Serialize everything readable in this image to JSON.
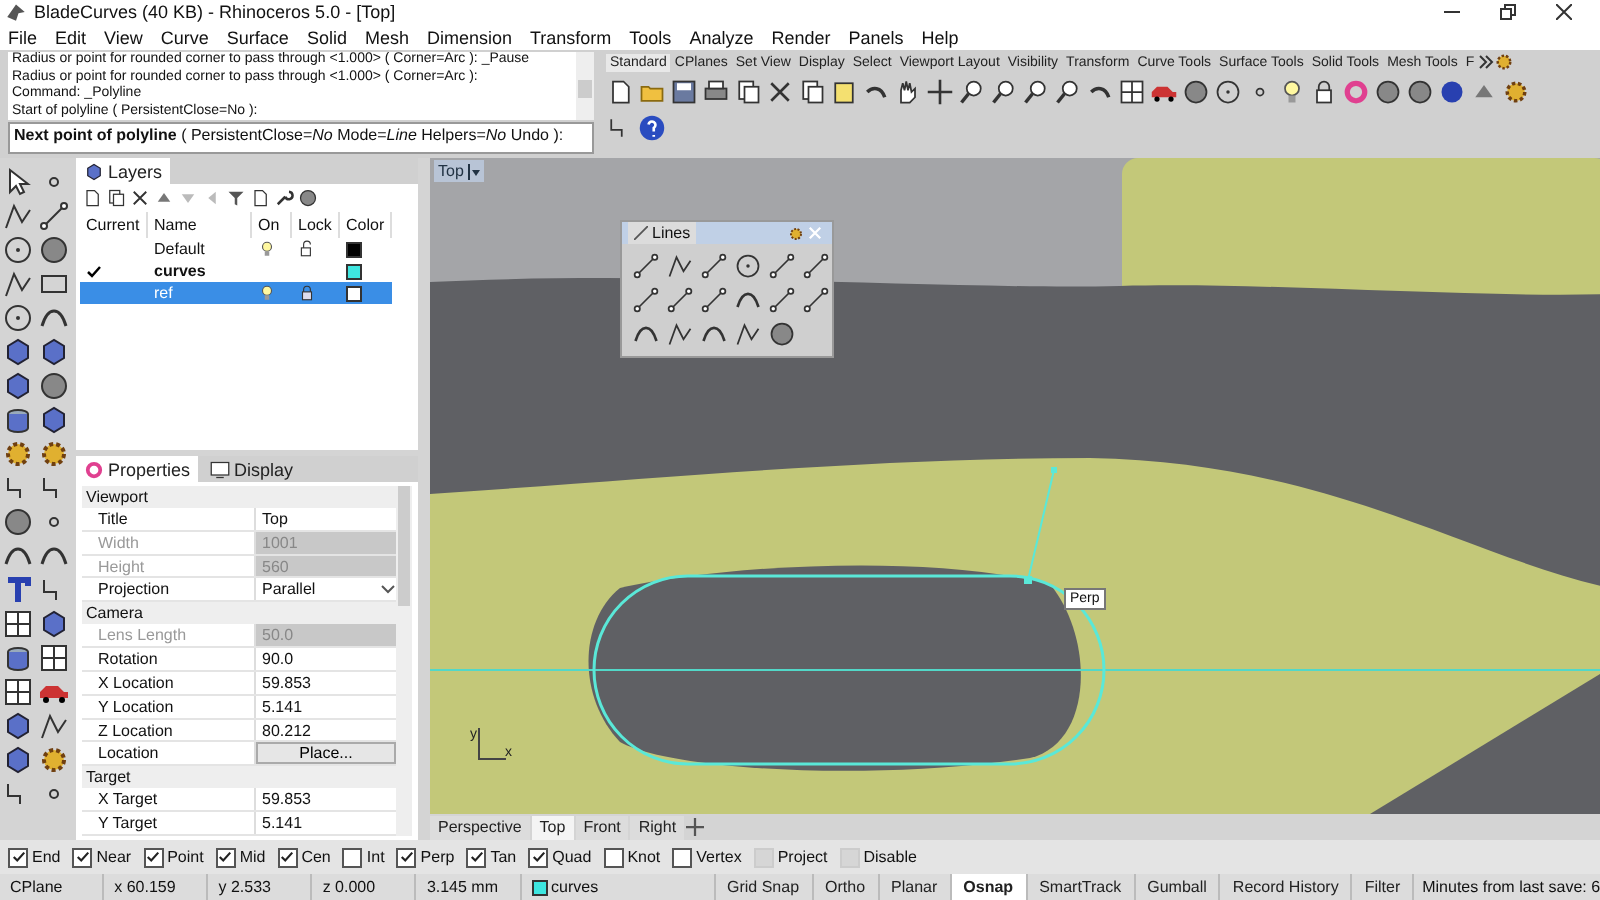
{
  "window": {
    "title": "BladeCurves (40 KB) - Rhinoceros 5.0 - [Top]"
  },
  "menu": [
    "File",
    "Edit",
    "View",
    "Curve",
    "Surface",
    "Solid",
    "Mesh",
    "Dimension",
    "Transform",
    "Tools",
    "Analyze",
    "Render",
    "Panels",
    "Help"
  ],
  "command": {
    "history": [
      "Radius or point for rounded corner to pass through <1.000> ( Corner=Arc ): _Pause",
      "Radius or point for rounded corner to pass through <1.000> ( Corner=Arc ):",
      "Command: _Polyline",
      "Start of polyline ( PersistentClose=No ):"
    ],
    "prompt": "**Next point of polyline** ( PersistentClose=*No* Mode=*Line* Helpers=*No* Undo ):"
  },
  "toolbar_tabs": [
    {
      "label": "Standard",
      "selected": true
    },
    {
      "label": "CPlanes",
      "selected": false
    },
    {
      "label": "Set View",
      "selected": false
    },
    {
      "label": "Display",
      "selected": false
    },
    {
      "label": "Select",
      "selected": false
    },
    {
      "label": "Viewport Layout",
      "selected": false
    },
    {
      "label": "Visibility",
      "selected": false
    },
    {
      "label": "Transform",
      "selected": false
    },
    {
      "label": "Curve Tools",
      "selected": false
    },
    {
      "label": "Surface Tools",
      "selected": false
    },
    {
      "label": "Solid Tools",
      "selected": false
    },
    {
      "label": "Mesh Tools",
      "selected": false
    },
    {
      "label": "F",
      "selected": false
    }
  ],
  "layers": {
    "title": "Layers",
    "columns": [
      "Current",
      "Name",
      "On",
      "Lock",
      "Color"
    ],
    "rows": [
      {
        "name": "Default",
        "current": false,
        "selected": false,
        "on": true,
        "locked": false,
        "color": "#000000"
      },
      {
        "name": "curves",
        "current": true,
        "selected": false,
        "color": "#3ee6e0"
      },
      {
        "name": "ref",
        "current": false,
        "selected": true,
        "on": true,
        "locked": true,
        "color": "#ffffff"
      }
    ]
  },
  "properties": {
    "tabs": [
      {
        "label": "Properties",
        "selected": true
      },
      {
        "label": "Display",
        "selected": false
      }
    ],
    "sections": [
      {
        "title": "Viewport",
        "rows": [
          {
            "kind": "text",
            "label": "Title",
            "value": "Top",
            "disabled": false
          },
          {
            "kind": "text",
            "label": "Width",
            "value": "1001",
            "disabled": true
          },
          {
            "kind": "text",
            "label": "Height",
            "value": "560",
            "disabled": true
          },
          {
            "kind": "dropdown",
            "label": "Projection",
            "value": "Parallel",
            "disabled": false
          }
        ]
      },
      {
        "title": "Camera",
        "rows": [
          {
            "kind": "text",
            "label": "Lens Length",
            "value": "50.0",
            "disabled": true
          },
          {
            "kind": "text",
            "label": "Rotation",
            "value": "90.0",
            "disabled": false
          },
          {
            "kind": "text",
            "label": "X Location",
            "value": "59.853",
            "disabled": false
          },
          {
            "kind": "text",
            "label": "Y Location",
            "value": "5.141",
            "disabled": false
          },
          {
            "kind": "text",
            "label": "Z Location",
            "value": "80.212",
            "disabled": false
          },
          {
            "kind": "button",
            "label": "Location",
            "value": "Place...",
            "disabled": false
          }
        ]
      },
      {
        "title": "Target",
        "rows": [
          {
            "kind": "text",
            "label": "X Target",
            "value": "59.853",
            "disabled": false
          },
          {
            "kind": "text",
            "label": "Y Target",
            "value": "5.141",
            "disabled": false
          }
        ]
      }
    ]
  },
  "viewport": {
    "label": "Top",
    "floating_toolbar": {
      "title": "Lines"
    },
    "tooltip": "Perp",
    "axis_labels": [
      "y",
      "x"
    ]
  },
  "viewport_tabs": [
    {
      "label": "Perspective",
      "selected": false
    },
    {
      "label": "Top",
      "selected": true
    },
    {
      "label": "Front",
      "selected": false
    },
    {
      "label": "Right",
      "selected": false
    }
  ],
  "osnaps": [
    {
      "label": "End",
      "checked": true,
      "disabled": false
    },
    {
      "label": "Near",
      "checked": true,
      "disabled": false
    },
    {
      "label": "Point",
      "checked": true,
      "disabled": false
    },
    {
      "label": "Mid",
      "checked": true,
      "disabled": false
    },
    {
      "label": "Cen",
      "checked": true,
      "disabled": false
    },
    {
      "label": "Int",
      "checked": false,
      "disabled": false
    },
    {
      "label": "Perp",
      "checked": true,
      "disabled": false
    },
    {
      "label": "Tan",
      "checked": true,
      "disabled": false
    },
    {
      "label": "Quad",
      "checked": true,
      "disabled": false
    },
    {
      "label": "Knot",
      "checked": false,
      "disabled": false
    },
    {
      "label": "Vertex",
      "checked": false,
      "disabled": false
    },
    {
      "label": "Project",
      "checked": false,
      "disabled": true
    },
    {
      "label": "Disable",
      "checked": false,
      "disabled": true
    }
  ],
  "status_bar": {
    "cells": [
      {
        "kind": "text",
        "text": "CPlane"
      },
      {
        "kind": "text",
        "text": "x 60.159"
      },
      {
        "kind": "text",
        "text": "y 2.533"
      },
      {
        "kind": "text",
        "text": "z 0.000"
      },
      {
        "kind": "text",
        "text": "3.145 mm"
      },
      {
        "kind": "layer",
        "text": "curves",
        "color": "#3ee6e0"
      }
    ],
    "panes": [
      {
        "label": "Grid Snap",
        "selected": false
      },
      {
        "label": "Ortho",
        "selected": false
      },
      {
        "label": "Planar",
        "selected": false
      },
      {
        "label": "Osnap",
        "selected": true
      },
      {
        "label": "SmartTrack",
        "selected": false
      },
      {
        "label": "Gumball",
        "selected": false
      },
      {
        "label": "Record History",
        "selected": false
      },
      {
        "label": "Filter",
        "selected": false
      }
    ],
    "save_note": "Minutes from last save: 6"
  }
}
